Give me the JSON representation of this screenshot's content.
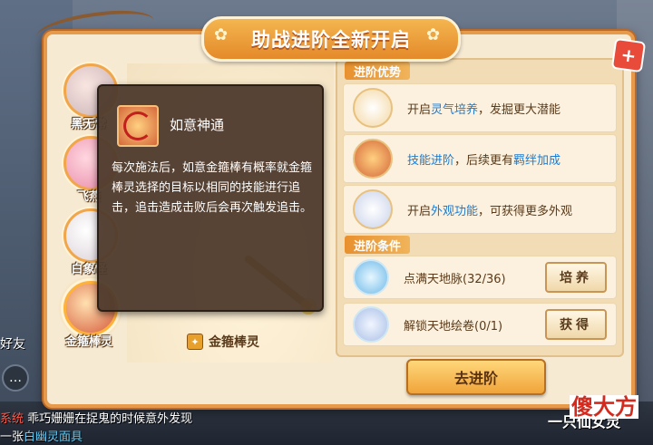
{
  "dialog": {
    "title": "助战进阶全新开启",
    "close_icon": "close-icon"
  },
  "tabs": [
    {
      "label": "黑无常",
      "active": false
    },
    {
      "label": "飞燕",
      "active": false
    },
    {
      "label": "白象怪",
      "active": false
    },
    {
      "label": "金箍棒灵",
      "active": true
    }
  ],
  "character": {
    "name": "金箍棒灵"
  },
  "tooltip": {
    "title": "如意神通",
    "description": "每次施法后，如意金箍棒有概率就金箍棒灵选择的目标以相同的技能进行追击，追击造成击败后会再次触发追击。"
  },
  "advantages": {
    "header": "进阶优势",
    "items": [
      {
        "prefix": "开启",
        "highlight": "灵气培养",
        "suffix": "，发掘更大潜能"
      },
      {
        "prefix": "",
        "highlight": "技能进阶",
        "suffix": "，后续更有",
        "highlight2": "羁绊加成"
      },
      {
        "prefix": "开启",
        "highlight": "外观功能",
        "suffix": "，可获得更多外观"
      }
    ]
  },
  "conditions": {
    "header": "进阶条件",
    "items": [
      {
        "text": "点满天地脉(32/36)",
        "button": "培养"
      },
      {
        "text": "解锁天地绘卷(0/1)",
        "button": "获得"
      }
    ]
  },
  "advance_button": "去进阶",
  "hud": {
    "friend": "好友",
    "chat_line1_tag": "系统",
    "chat_line1": "乖巧姗姗在捉鬼的时候意外发现",
    "chat_line2_prefix": "一张",
    "chat_line2_item": "白幽灵面具",
    "bottom_right": "一只仙女灵",
    "watermark": "傻大方"
  },
  "colors": {
    "accent": "#e8902e",
    "highlight": "#1c7bd1",
    "close": "#e84b3a"
  }
}
